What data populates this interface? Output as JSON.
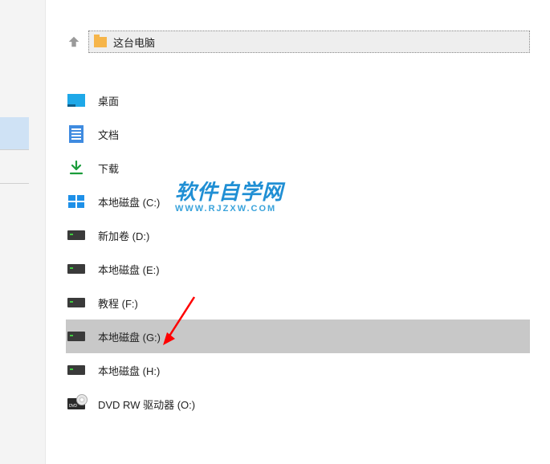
{
  "breadcrumb": {
    "label": "这台电脑"
  },
  "items": [
    {
      "icon": "desktop",
      "label": "桌面"
    },
    {
      "icon": "document",
      "label": "文档"
    },
    {
      "icon": "download",
      "label": "下载"
    },
    {
      "icon": "win",
      "label": "本地磁盘 (C:)"
    },
    {
      "icon": "drive",
      "label": "新加卷 (D:)"
    },
    {
      "icon": "drive",
      "label": "本地磁盘 (E:)"
    },
    {
      "icon": "drive",
      "label": "教程 (F:)"
    },
    {
      "icon": "drive",
      "label": "本地磁盘 (G:)",
      "selected": true
    },
    {
      "icon": "drive",
      "label": "本地磁盘 (H:)"
    },
    {
      "icon": "dvd",
      "label": "DVD RW 驱动器 (O:)"
    }
  ],
  "watermark": {
    "title": "软件自学网",
    "url": "WWW.RJZXW.COM"
  }
}
